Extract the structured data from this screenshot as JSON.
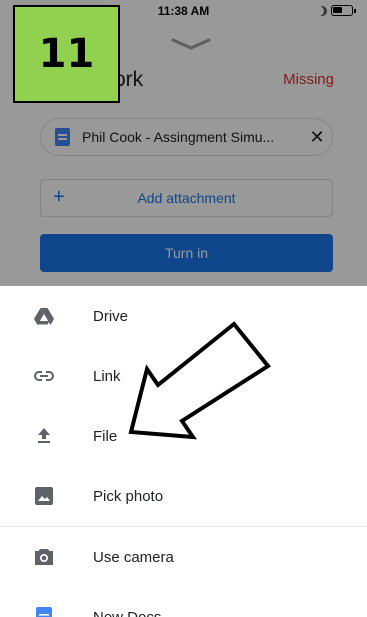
{
  "status_bar": {
    "time": "11:38 AM"
  },
  "header": {
    "title_partial": "ork",
    "status": "Missing"
  },
  "attachment": {
    "name": "Phil Cook - Assingment Simu...",
    "remove": "✕"
  },
  "actions": {
    "add_plus": "+",
    "add_attachment": "Add attachment",
    "turn_in": "Turn in"
  },
  "badge": {
    "number": "11"
  },
  "menu": {
    "items": [
      {
        "label": "Drive",
        "icon": "drive-icon"
      },
      {
        "label": "Link",
        "icon": "link-icon"
      },
      {
        "label": "File",
        "icon": "upload-icon"
      },
      {
        "label": "Pick photo",
        "icon": "photo-icon"
      },
      {
        "label": "Use camera",
        "icon": "camera-icon"
      },
      {
        "label": "New Docs",
        "icon": "docs-icon"
      }
    ]
  },
  "colors": {
    "accent": "#1a73e8",
    "missing": "#d93025",
    "badge": "#92d050",
    "docs": "#4285f4"
  }
}
